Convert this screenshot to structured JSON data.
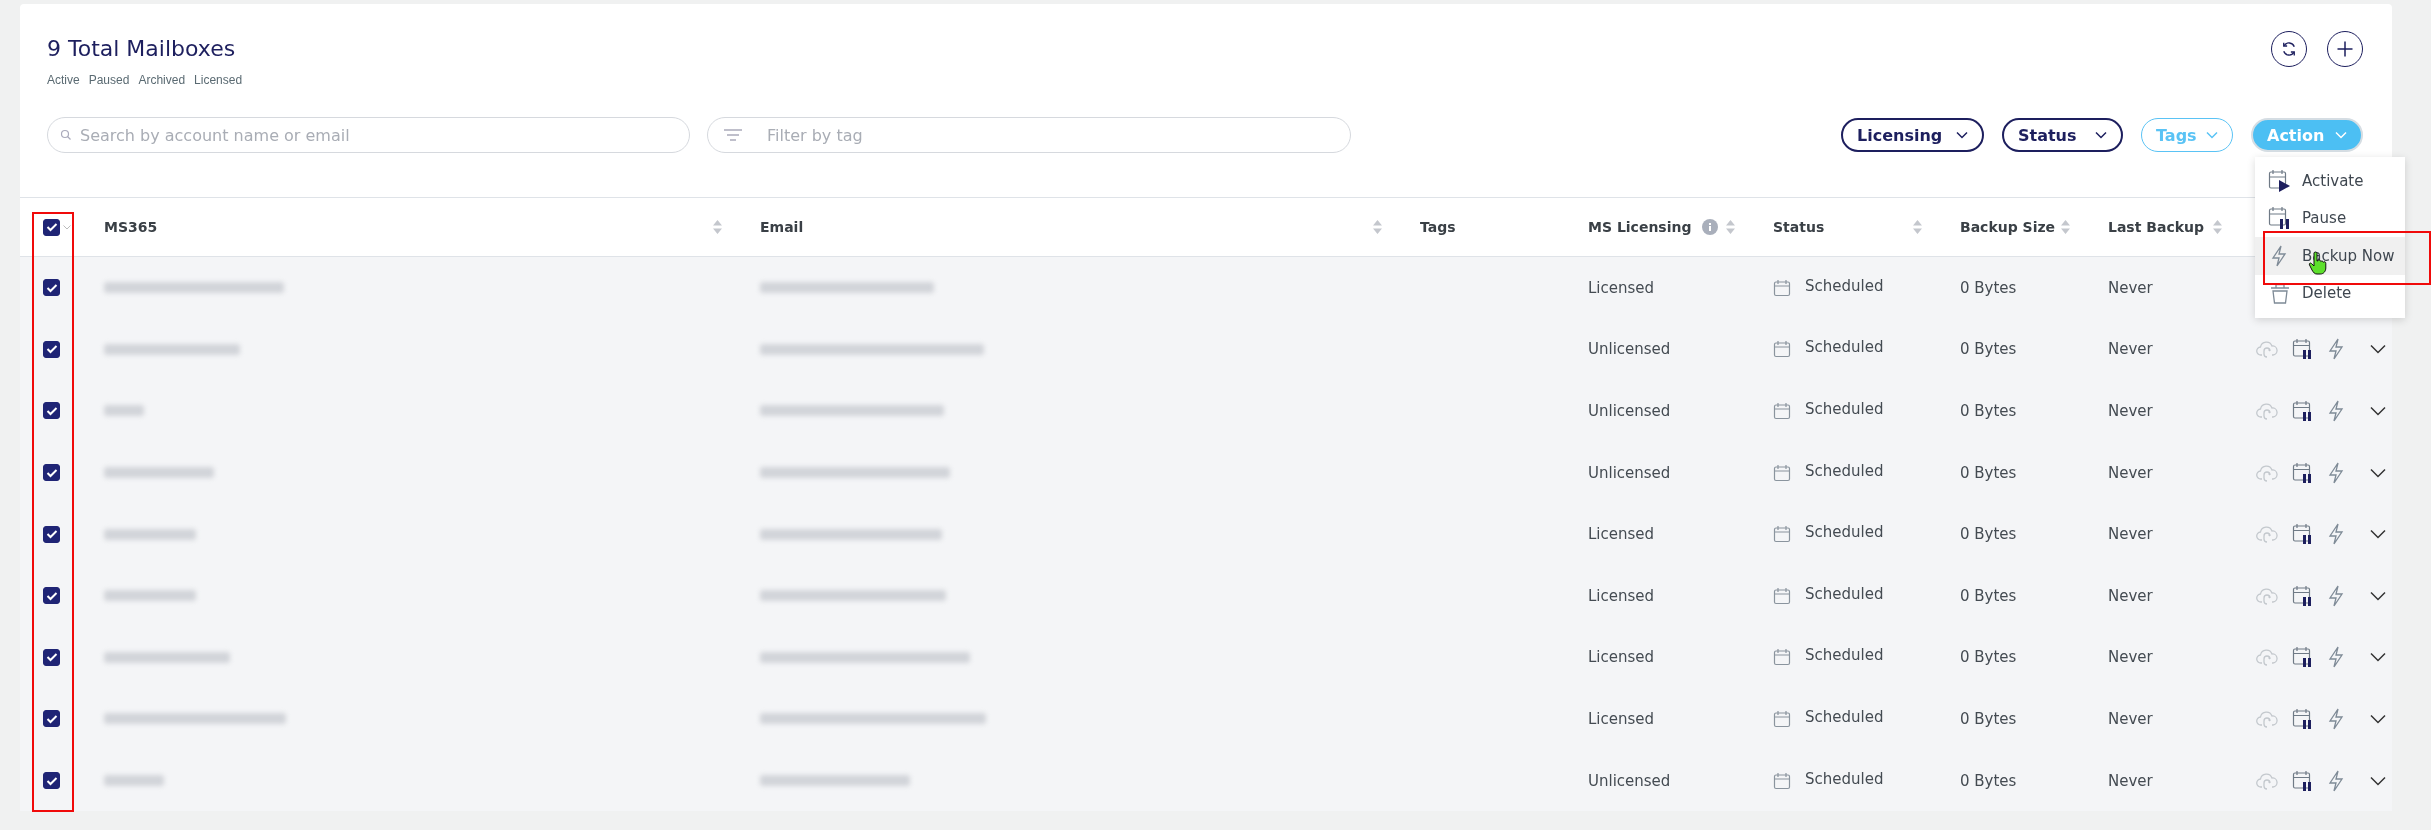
{
  "header": {
    "title": "9 Total Mailboxes",
    "status_links": [
      "Active",
      "Paused",
      "Archived",
      "Licensed"
    ]
  },
  "toolbar": {
    "search": {
      "placeholder": "Search by account name or email"
    },
    "tag_filter": {
      "placeholder": "Filter by tag"
    },
    "dropdowns": [
      {
        "label": "Licensing",
        "kind": "outline"
      },
      {
        "label": "Status",
        "kind": "outline"
      },
      {
        "label": "Tags",
        "kind": "light"
      },
      {
        "label": "Action",
        "kind": "filled"
      }
    ]
  },
  "action_menu": {
    "open": true,
    "items": [
      {
        "label": "Activate",
        "kind": "activate",
        "selected": false
      },
      {
        "label": "Pause",
        "kind": "pause",
        "selected": false
      },
      {
        "label": "Backup Now",
        "kind": "backup",
        "selected": true
      },
      {
        "label": "Delete",
        "kind": "delete",
        "selected": false
      }
    ]
  },
  "table": {
    "select_all": {
      "checked": true
    },
    "columns": [
      {
        "label": "MS365",
        "sortable": true,
        "info": false
      },
      {
        "label": "Email",
        "sortable": true,
        "info": false
      },
      {
        "label": "Tags",
        "sortable": false,
        "info": false
      },
      {
        "label": "MS Licensing",
        "sortable": true,
        "info": true
      },
      {
        "label": "Status",
        "sortable": true,
        "info": false
      },
      {
        "label": "Backup Size",
        "sortable": true,
        "info": false
      },
      {
        "label": "Last Backup",
        "sortable": true,
        "info": false
      }
    ],
    "rows": [
      {
        "selected": true,
        "licensing": "Licensed",
        "status": "Scheduled",
        "backup_size": "0 Bytes",
        "last_backup": "Never"
      },
      {
        "selected": true,
        "licensing": "Unlicensed",
        "status": "Scheduled",
        "backup_size": "0 Bytes",
        "last_backup": "Never"
      },
      {
        "selected": true,
        "licensing": "Unlicensed",
        "status": "Scheduled",
        "backup_size": "0 Bytes",
        "last_backup": "Never"
      },
      {
        "selected": true,
        "licensing": "Unlicensed",
        "status": "Scheduled",
        "backup_size": "0 Bytes",
        "last_backup": "Never"
      },
      {
        "selected": true,
        "licensing": "Licensed",
        "status": "Scheduled",
        "backup_size": "0 Bytes",
        "last_backup": "Never"
      },
      {
        "selected": true,
        "licensing": "Licensed",
        "status": "Scheduled",
        "backup_size": "0 Bytes",
        "last_backup": "Never"
      },
      {
        "selected": true,
        "licensing": "Licensed",
        "status": "Scheduled",
        "backup_size": "0 Bytes",
        "last_backup": "Never"
      },
      {
        "selected": true,
        "licensing": "Licensed",
        "status": "Scheduled",
        "backup_size": "0 Bytes",
        "last_backup": "Never"
      },
      {
        "selected": true,
        "licensing": "Unlicensed",
        "status": "Scheduled",
        "backup_size": "0 Bytes",
        "last_backup": "Never"
      }
    ]
  },
  "highlights": {
    "checkbox_column": true,
    "hovered_menu_item": true
  }
}
